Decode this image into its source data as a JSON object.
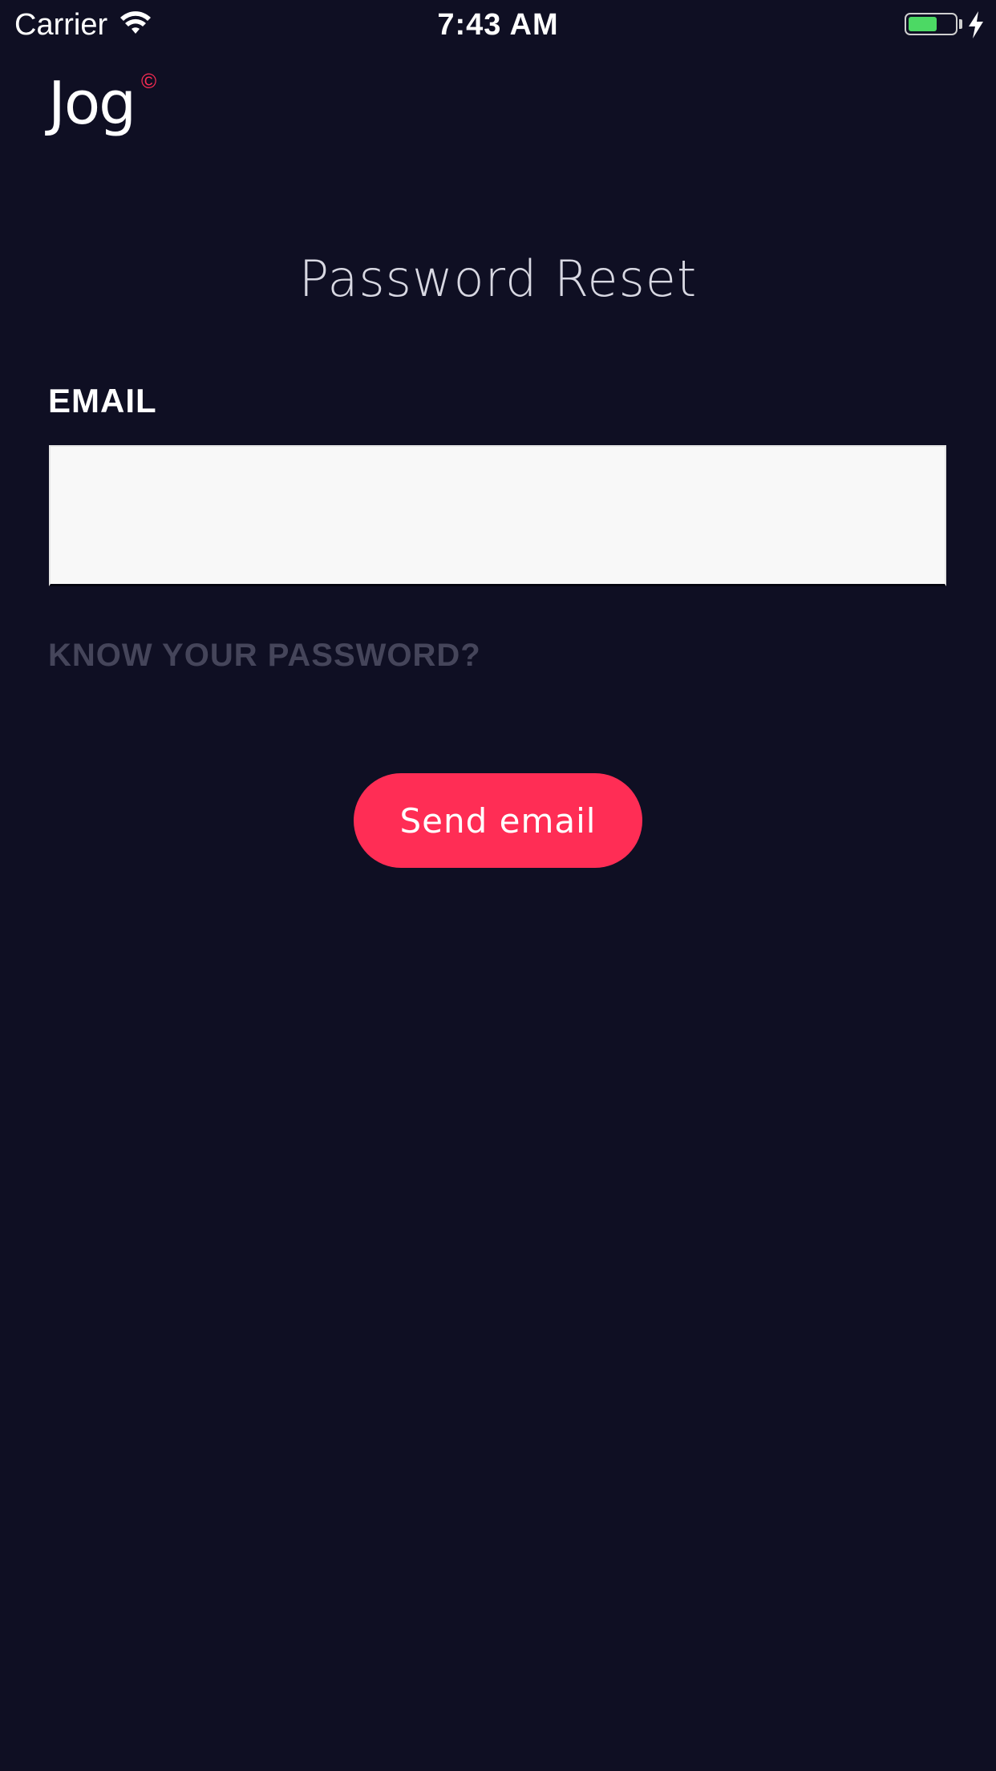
{
  "status_bar": {
    "carrier": "Carrier",
    "time": "7:43 AM",
    "battery_level": 0.62,
    "charging": true,
    "battery_color": "#4cd964"
  },
  "logo": {
    "text": "Jog",
    "mark": "©",
    "mark_color": "#ff2d55"
  },
  "page": {
    "title": "Password Reset",
    "background_color": "#0f0f23"
  },
  "form": {
    "email_label": "EMAIL",
    "email_value": "",
    "email_placeholder": "",
    "know_password_link": "KNOW YOUR PASSWORD?",
    "send_button_label": "Send email",
    "accent_color": "#ff2d55"
  },
  "icons": {
    "wifi": "wifi-icon",
    "battery": "battery-icon",
    "charging": "charging-bolt-icon"
  }
}
